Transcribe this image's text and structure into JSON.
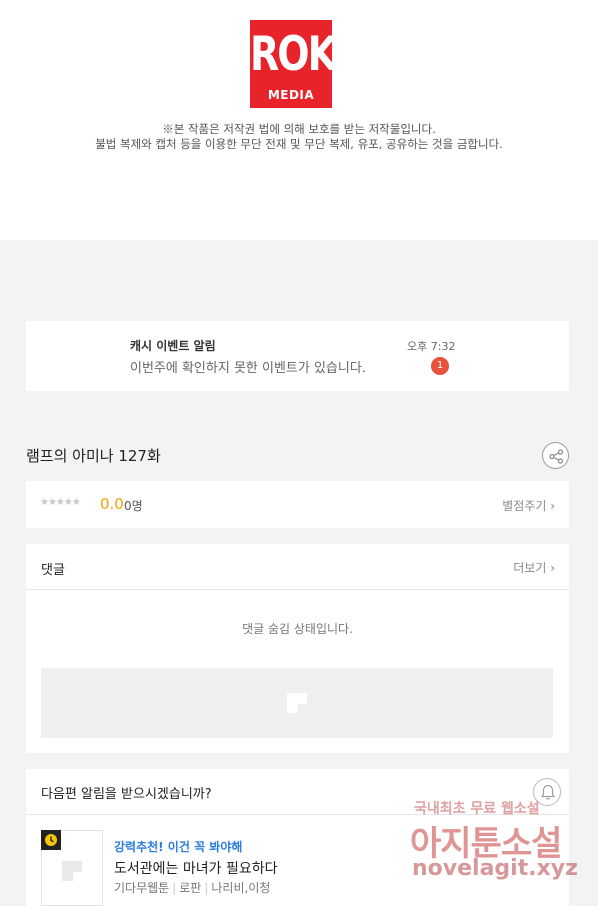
{
  "publisher": {
    "logo_main": "ROK",
    "logo_sub": "MEDIA",
    "copyright_line1": "※본 작품은 저작권 법에 의해 보호를 받는 저작물입니다.",
    "copyright_line2": "불법 복제와 캡처 등을 이용한 무단 전재 및 무단 복제, 유포, 공유하는 것을 금합니다."
  },
  "notice": {
    "title": "캐시 이벤트 알림",
    "message": "이번주에 확인하지 못한 이벤트가 있습니다.",
    "time": "오후 7:32",
    "badge": "1"
  },
  "episode": {
    "title": "램프의 아미나 127화",
    "share_icon": "share-icon"
  },
  "rating": {
    "stars": "★★★★★",
    "score": "0.0",
    "count": "0명",
    "rate_link": "별점주기 ›"
  },
  "comments": {
    "title": "댓글",
    "more_link": "더보기 ›",
    "hidden_message": "댓글 숨김 상태입니다."
  },
  "next_alert": {
    "title": "다음편 알림을 받으시겠습니까?",
    "bell_icon": "bell-icon"
  },
  "recommendation": {
    "label": "강력추천! 이건 꼭 봐야해",
    "title": "도서관에는 마녀가 필요하다",
    "meta": [
      "기다무웹툰",
      "로판",
      "나리비,이청"
    ]
  },
  "watermark": {
    "line1": "국내최초 무료 웹소설",
    "line2": "아지툰소설",
    "line3": "novelagit.xyz"
  },
  "colors": {
    "brand_red": "#e8232a",
    "score_yellow": "#f0a300",
    "link_blue": "#2a7de1",
    "badge_red": "#e8523d"
  }
}
